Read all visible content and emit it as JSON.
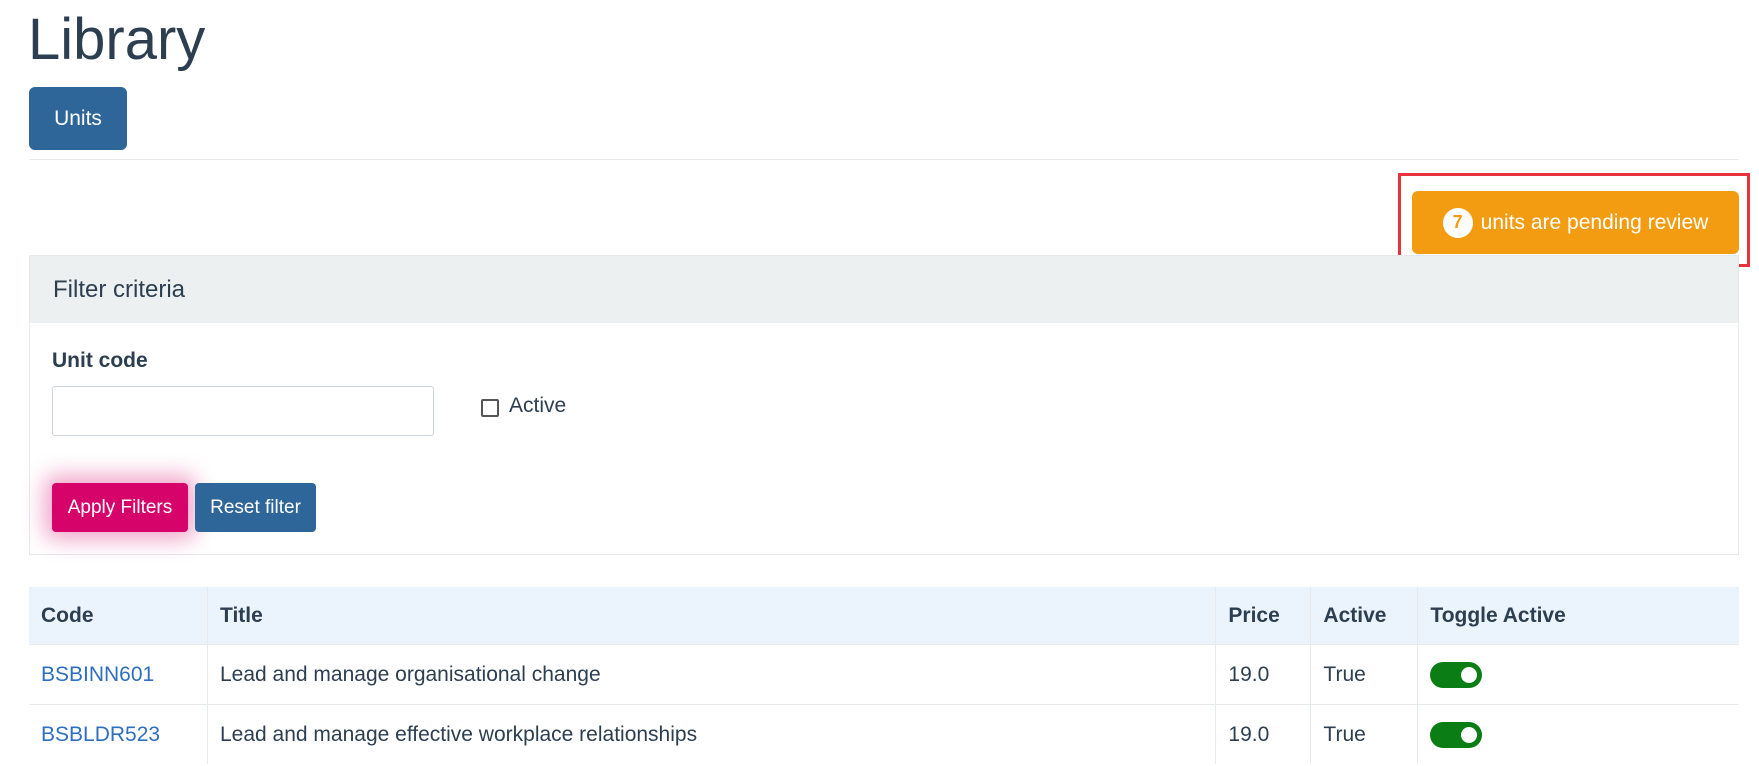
{
  "page": {
    "title": "Library"
  },
  "tabs": {
    "units_label": "Units"
  },
  "pending": {
    "count": "7",
    "label": "units are pending review"
  },
  "filter": {
    "header": "Filter criteria",
    "unit_code_label": "Unit code",
    "unit_code_value": "",
    "active_label": "Active",
    "active_checked": false,
    "apply_label": "Apply Filters",
    "reset_label": "Reset filter"
  },
  "table": {
    "headers": {
      "code": "Code",
      "title": "Title",
      "price": "Price",
      "active": "Active",
      "toggle": "Toggle Active"
    },
    "rows": [
      {
        "code": "BSBINN601",
        "title": "Lead and manage organisational change",
        "price": "19.0",
        "active": "True",
        "toggle_on": true
      },
      {
        "code": "BSBLDR523",
        "title": "Lead and manage effective workplace relationships",
        "price": "19.0",
        "active": "True",
        "toggle_on": true
      }
    ]
  },
  "colors": {
    "primary": "#2f6699",
    "warning": "#f39c12",
    "apply": "#d6036b",
    "highlight_border": "#e8333b",
    "toggle_on": "#0a7d14",
    "link": "#2f6fbf"
  }
}
